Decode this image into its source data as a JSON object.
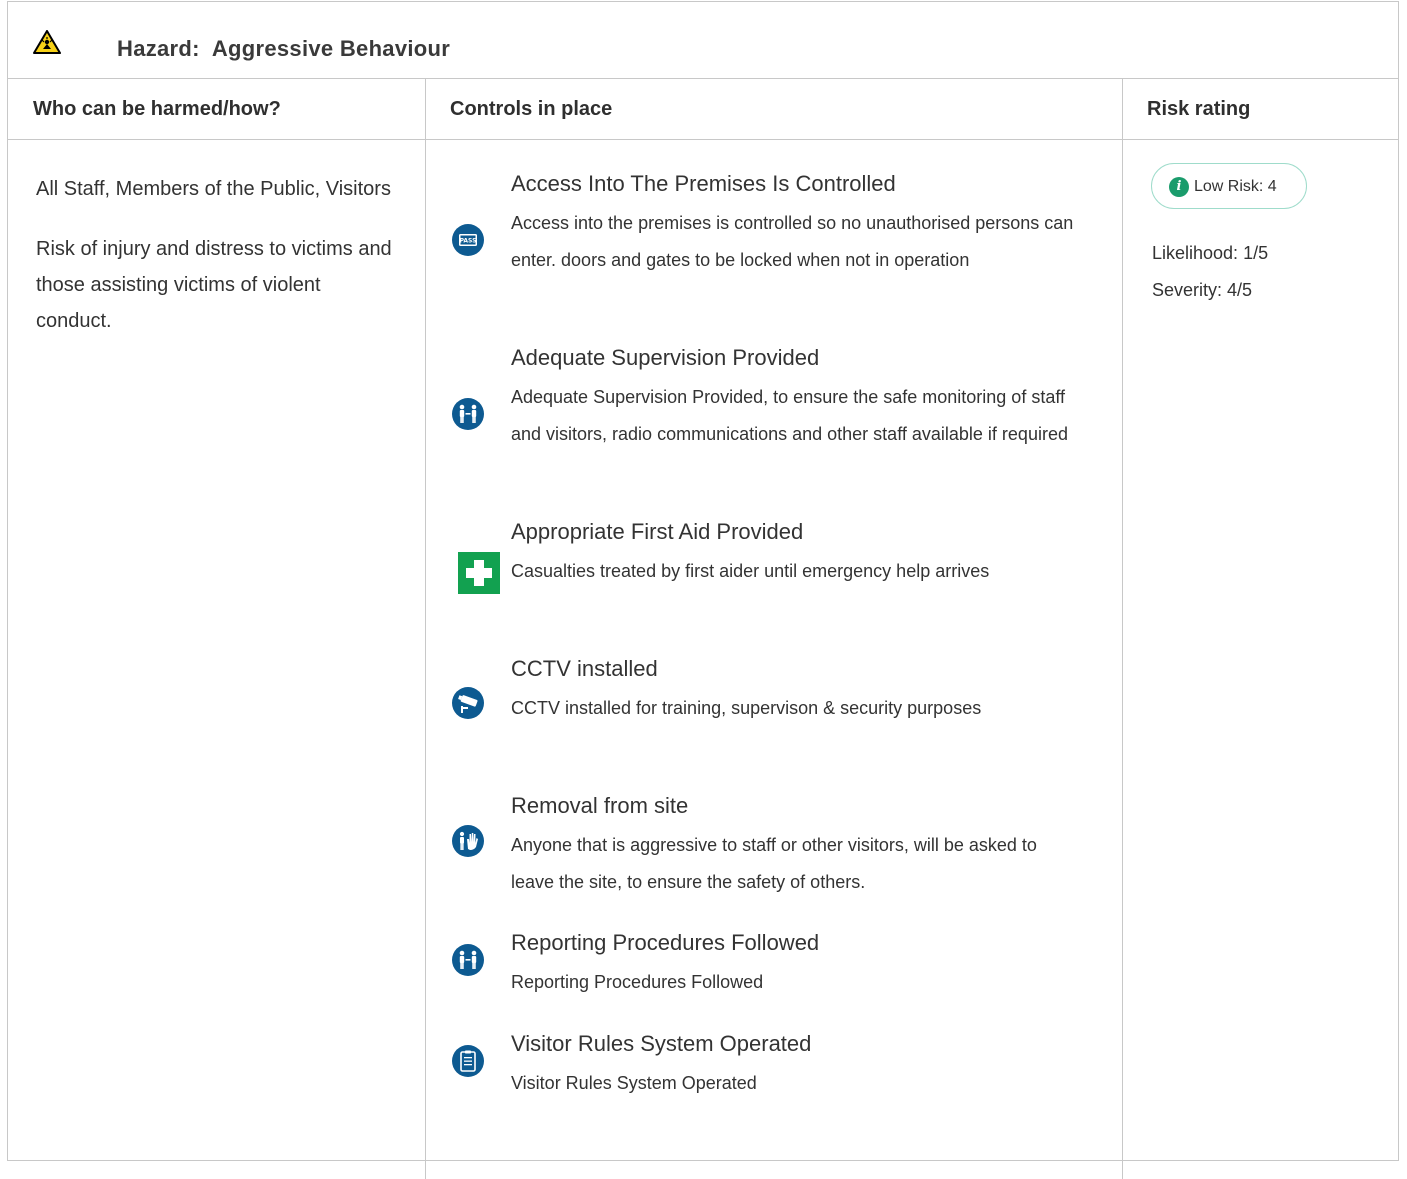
{
  "hazard": {
    "prefix": "Hazard:",
    "name": "Aggressive Behaviour",
    "icon": "warning-aggression-icon"
  },
  "columns": {
    "who": "Who can be harmed/how?",
    "controls": "Controls in place",
    "risk": "Risk rating"
  },
  "who": {
    "persons": "All Staff, Members of the Public, Visitors",
    "how": "Risk of injury and distress to victims and those assisting victims of violent conduct."
  },
  "controls": [
    {
      "icon": "pass-card-icon",
      "title": "Access Into The Premises Is Controlled",
      "description": "Access into the premises is controlled so no unauthorised persons can enter. doors and gates to be locked when not in operation"
    },
    {
      "icon": "supervision-people-icon",
      "title": "Adequate Supervision Provided",
      "description": "Adequate Supervision Provided, to ensure the safe monitoring of staff and visitors, radio communications and other staff available if required"
    },
    {
      "icon": "first-aid-icon",
      "title": "Appropriate First Aid Provided",
      "description": "Casualties treated by first aider until emergency help arrives"
    },
    {
      "icon": "cctv-camera-icon",
      "title": "CCTV installed",
      "description": "CCTV installed for training, supervison & security purposes"
    },
    {
      "icon": "stop-hand-icon",
      "title": "Removal from site",
      "description": "Anyone that is aggressive to staff or other visitors, will be asked to leave the site, to ensure the safety of others."
    },
    {
      "icon": "reporting-people-icon",
      "title": "Reporting Procedures Followed",
      "description": "Reporting Procedures Followed"
    },
    {
      "icon": "clipboard-rules-icon",
      "title": "Visitor Rules System Operated",
      "description": "Visitor Rules System Operated"
    }
  ],
  "risk": {
    "badge": "Low Risk: 4",
    "info_icon": "info-icon",
    "likelihood": "Likelihood: 1/5",
    "severity": "Severity: 4/5"
  },
  "colors": {
    "border": "#c8c8c8",
    "icon_blue": "#0d5a91",
    "first_aid_green": "#12a150",
    "risk_green": "#1a9c6c",
    "badge_border": "#9fdccb",
    "warning_yellow": "#f7d117"
  }
}
